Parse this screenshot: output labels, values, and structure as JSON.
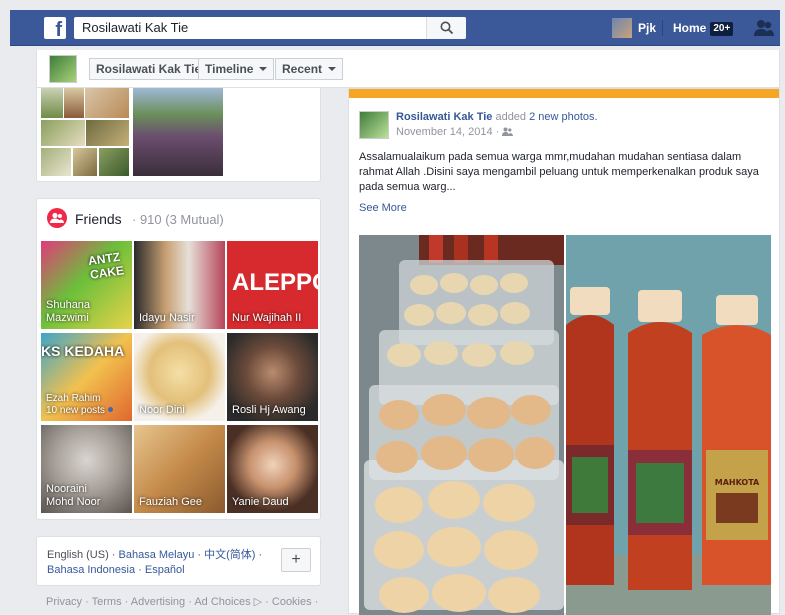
{
  "topbar": {
    "logo": "f",
    "search_value": "Rosilawati Kak Tie",
    "user_name": "Pjk",
    "home_label": "Home",
    "home_badge": "20+"
  },
  "subnav": {
    "page_name": "Rosilawati Kak Tie",
    "timeline": "Timeline",
    "recent": "Recent"
  },
  "friends": {
    "title": "Friends",
    "count": "· 910 (3 Mutual)",
    "tiles": [
      {
        "name": "Shuhana Mazwimi"
      },
      {
        "name": "Idayu Nasir"
      },
      {
        "name": "Nur Wajihah II"
      },
      {
        "name": "Ezah Rahim",
        "sub": "10 new posts"
      },
      {
        "name": "Noor Dini"
      },
      {
        "name": "Rosli Hj Awang"
      },
      {
        "name": "Nooraini Mohd Noor"
      },
      {
        "name": "Fauziah Gee"
      },
      {
        "name": "Yanie Daud"
      }
    ],
    "tile_texts": {
      "antz_cake": "ANTZ CAKE",
      "aleppo": "ALEPPO",
      "ks": "KS KEDAHA"
    }
  },
  "languages": {
    "current": "English (US) ·",
    "l1": "Bahasa Melayu",
    "l2": "中文(简体)",
    "l3": "Bahasa Indonesia",
    "l4": "Español",
    "plus": "+"
  },
  "footer": "Privacy · Terms · Advertising · Ad Choices ▷ · Cookies ·",
  "post": {
    "author": "Rosilawati Kak Tie",
    "action": "added",
    "photos_link": "2 new photos.",
    "date": "November 14, 2014 ·",
    "body": "Assalamualaikum pada semua warga mmr,mudahan mudahan sentiasa dalam rahmat Allah .Disini saya mengambil peluang untuk memperkenalkan produk saya pada semua warg...",
    "see_more": "See More",
    "bottle_label": "MAHKOTA"
  },
  "colors": {
    "brand": "#3b5998",
    "link": "#365899",
    "friends_icon": "#f02849",
    "strip": "#f5a623"
  }
}
